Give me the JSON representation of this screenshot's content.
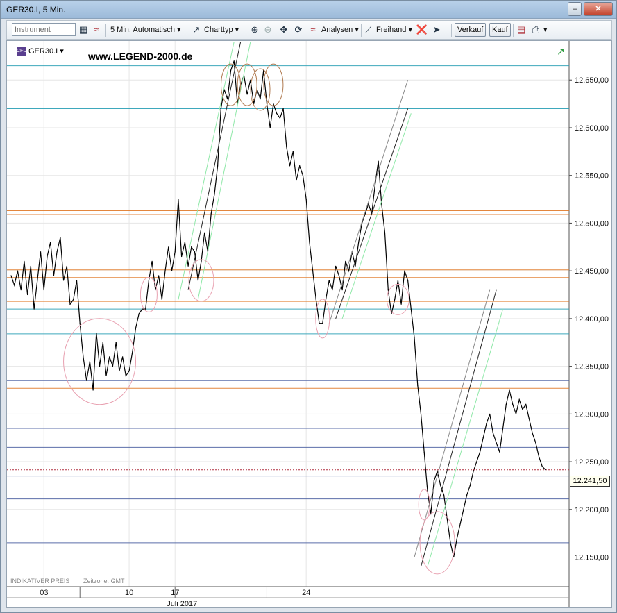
{
  "window": {
    "title": "GER30.I, 5 Min."
  },
  "toolbar": {
    "instrument_placeholder": "Instrument",
    "interval_label": "5 Min,  Automatisch",
    "charttype_label": "Charttyp",
    "analysen_label": "Analysen",
    "freihand_label": "Freihand",
    "verkauf_label": "Verkauf",
    "kauf_label": "Kauf"
  },
  "chart": {
    "symbol": "GER30.I",
    "watermark": "www.LEGEND-2000.de",
    "indicative_note": "INDIKATIVER PREIS",
    "timezone_note": "Zeitzone: GMT",
    "month_label": "Juli 2017",
    "current_price_label": "12.241,50"
  },
  "chart_data": {
    "type": "line",
    "title": "",
    "xlabel": "Juli 2017",
    "ylabel": "",
    "ylim": [
      12130,
      12680
    ],
    "y_ticks": [
      {
        "value": 12650,
        "label": "12.650,00"
      },
      {
        "value": 12600,
        "label": "12.600,00"
      },
      {
        "value": 12550,
        "label": "12.550,00"
      },
      {
        "value": 12500,
        "label": "12.500,00"
      },
      {
        "value": 12450,
        "label": "12.450,00"
      },
      {
        "value": 12400,
        "label": "12.400,00"
      },
      {
        "value": 12350,
        "label": "12.350,00"
      },
      {
        "value": 12300,
        "label": "12.300,00"
      },
      {
        "value": 12250,
        "label": "12.250,00"
      },
      {
        "value": 12200,
        "label": "12.200,00"
      },
      {
        "value": 12150,
        "label": "12.150,00"
      }
    ],
    "x_ticks": [
      {
        "bar": 10,
        "label": "03"
      },
      {
        "bar": 36,
        "label": "10"
      },
      {
        "bar": 50,
        "label": "17"
      },
      {
        "bar": 90,
        "label": "24"
      }
    ],
    "session_separators": [
      21,
      50,
      78
    ],
    "series": [
      {
        "values": [
          12445,
          12435,
          12450,
          12430,
          12460,
          12425,
          12455,
          12410,
          12440,
          12470,
          12430,
          12465,
          12480,
          12445,
          12470,
          12485,
          12440,
          12455,
          12415,
          12420,
          12440,
          12395,
          12360,
          12335,
          12355,
          12325,
          12385,
          12350,
          12375,
          12340,
          12360,
          12350,
          12375,
          12345,
          12360,
          12340,
          12345,
          12365,
          12390,
          12405,
          12410,
          12410,
          12440,
          12460,
          12430,
          12445,
          12420,
          12450,
          12475,
          12450,
          12470,
          12525,
          12465,
          12480,
          12455,
          12475,
          12470,
          12440,
          12460,
          12490,
          12470,
          12510,
          12530,
          12560,
          12620,
          12640,
          12630,
          12660,
          12670,
          12625,
          12645,
          12655,
          12635,
          12650,
          12625,
          12640,
          12630,
          12660,
          12625,
          12600,
          12625,
          12615,
          12610,
          12620,
          12580,
          12560,
          12575,
          12545,
          12560,
          12550,
          12525,
          12480,
          12450,
          12420,
          12395,
          12395,
          12420,
          12440,
          12430,
          12455,
          12445,
          12430,
          12460,
          12450,
          12470,
          12455,
          12480,
          12500,
          12510,
          12520,
          12510,
          12540,
          12565,
          12520,
          12490,
          12430,
          12405,
          12420,
          12440,
          12415,
          12450,
          12440,
          12410,
          12380,
          12330,
          12300,
          12260,
          12220,
          12195,
          12230,
          12240,
          12225,
          12215,
          12190,
          12165,
          12150,
          12170,
          12185,
          12200,
          12215,
          12225,
          12240,
          12250,
          12260,
          12275,
          12290,
          12300,
          12280,
          12270,
          12260,
          12285,
          12310,
          12325,
          12310,
          12300,
          12315,
          12305,
          12310,
          12295,
          12280,
          12270,
          12255,
          12245,
          12241.5
        ]
      }
    ],
    "horizontal_lines": [
      {
        "price": 12665,
        "color": "#2a9fb5"
      },
      {
        "price": 12620,
        "color": "#2a9fb5"
      },
      {
        "price": 12410,
        "color": "#2a9fb5"
      },
      {
        "price": 12384,
        "color": "#2a9fb5"
      },
      {
        "price": 12443,
        "color": "#e07a28"
      },
      {
        "price": 12418,
        "color": "#e07a28"
      },
      {
        "price": 12513,
        "color": "#e07a28"
      },
      {
        "price": 12509,
        "color": "#e07a28"
      },
      {
        "price": 12451,
        "color": "#e07a28"
      },
      {
        "price": 12409,
        "color": "#e07a28"
      },
      {
        "price": 12327,
        "color": "#e07a28"
      },
      {
        "price": 12335,
        "color": "#4a5fa0"
      },
      {
        "price": 12285,
        "color": "#4a5fa0"
      },
      {
        "price": 12265,
        "color": "#4a5fa0"
      },
      {
        "price": 12235,
        "color": "#4a5fa0"
      },
      {
        "price": 12211,
        "color": "#4a5fa0"
      },
      {
        "price": 12165,
        "color": "#4a5fa0"
      }
    ],
    "current_price": 12241.5
  }
}
